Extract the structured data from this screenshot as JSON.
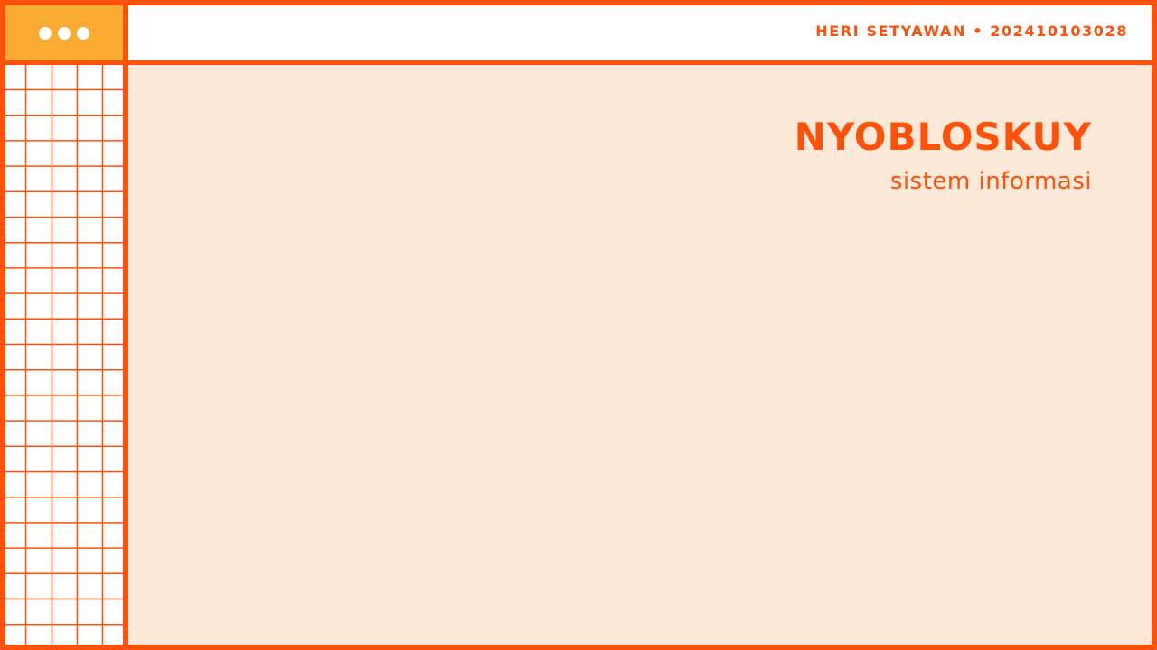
{
  "window_controls": {
    "dots": [
      "dot-icon",
      "dot-icon",
      "dot-icon"
    ],
    "color": "#FAAB32"
  },
  "header": {
    "author": "HERI SETYAWAN • 202410103028"
  },
  "main": {
    "title": "NYOBLOSKUY",
    "subtitle": "sistem informasi"
  },
  "colors": {
    "accent": "#FF5109",
    "window_controls_bg": "#FAAB32",
    "content_bg": "#FDE9D7",
    "header_bg": "#FFFFFF",
    "grid_bg": "#FFFFFF"
  }
}
